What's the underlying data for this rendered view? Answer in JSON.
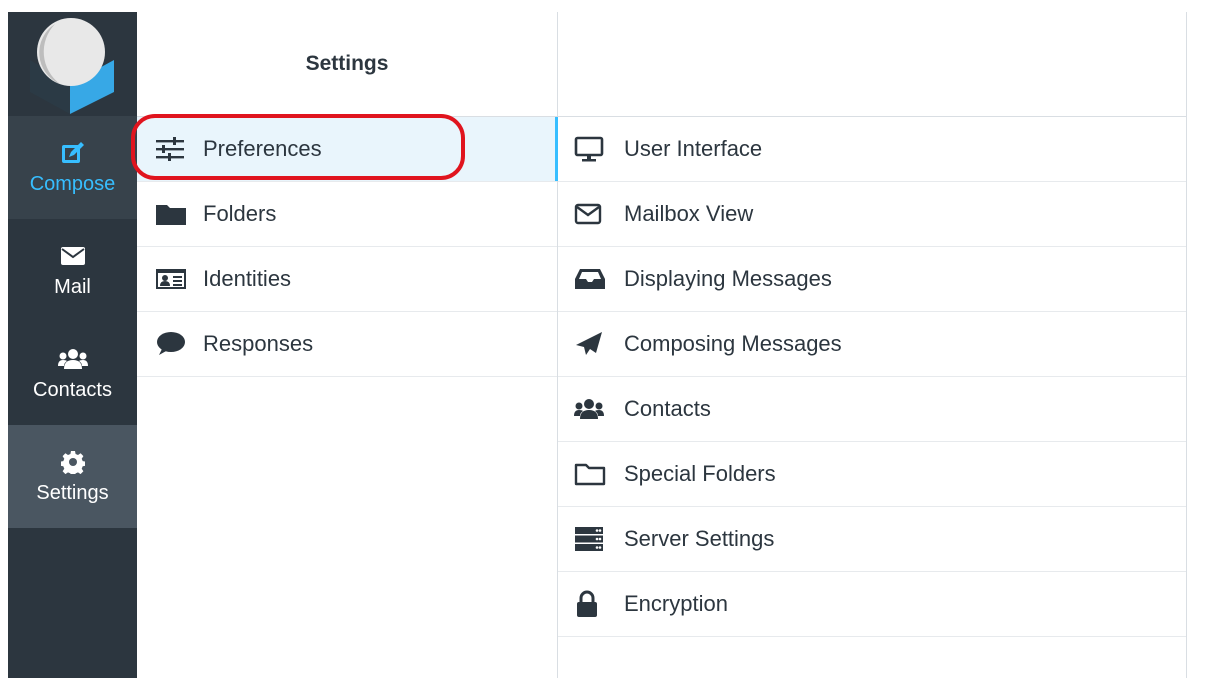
{
  "nav": {
    "items": [
      {
        "label": "Compose",
        "icon": "compose-icon"
      },
      {
        "label": "Mail",
        "icon": "envelope-icon"
      },
      {
        "label": "Contacts",
        "icon": "users-icon"
      },
      {
        "label": "Settings",
        "icon": "gear-icon"
      }
    ],
    "active": "Settings"
  },
  "settings": {
    "title": "Settings",
    "items": [
      {
        "label": "Preferences",
        "icon": "sliders-icon",
        "selected": true
      },
      {
        "label": "Folders",
        "icon": "folder-icon"
      },
      {
        "label": "Identities",
        "icon": "id-card-icon"
      },
      {
        "label": "Responses",
        "icon": "speech-bubble-icon"
      }
    ]
  },
  "preferences": {
    "items": [
      {
        "label": "User Interface",
        "icon": "monitor-icon"
      },
      {
        "label": "Mailbox View",
        "icon": "envelope-outline-icon"
      },
      {
        "label": "Displaying Messages",
        "icon": "inbox-icon"
      },
      {
        "label": "Composing Messages",
        "icon": "paper-plane-icon"
      },
      {
        "label": "Contacts",
        "icon": "users-icon"
      },
      {
        "label": "Special Folders",
        "icon": "folder-outline-icon"
      },
      {
        "label": "Server Settings",
        "icon": "server-icon"
      },
      {
        "label": "Encryption",
        "icon": "lock-icon"
      }
    ]
  },
  "colors": {
    "sidebar_bg": "#2c363f",
    "accent": "#37beff",
    "highlight": "#e0141e"
  }
}
